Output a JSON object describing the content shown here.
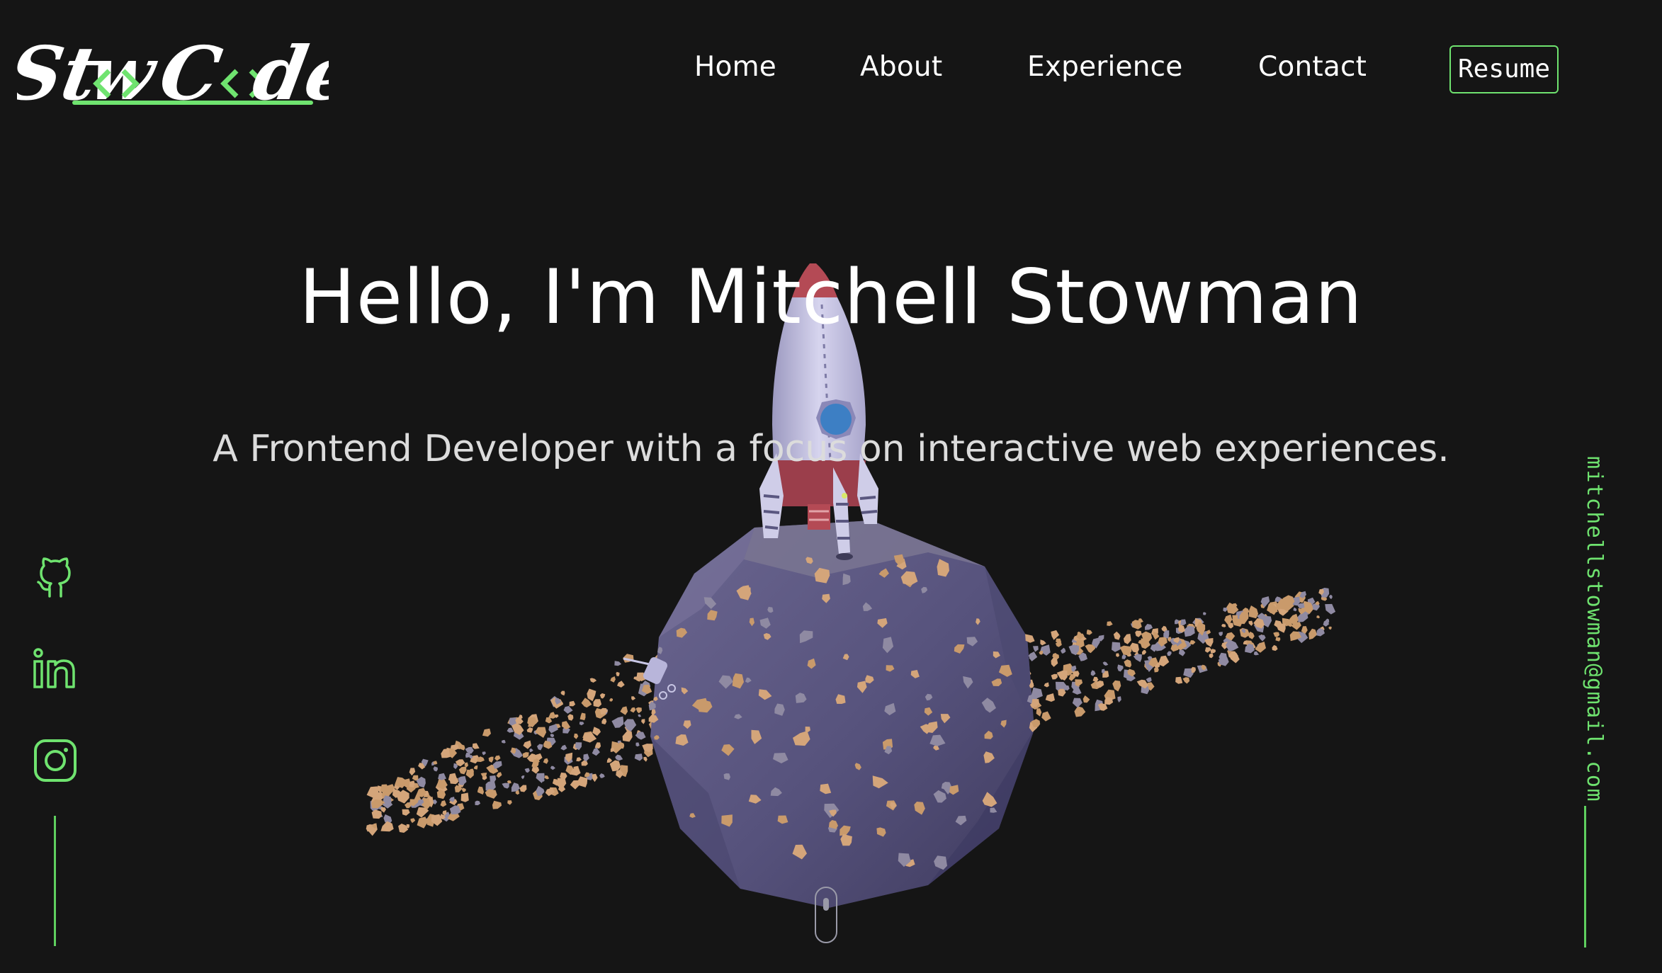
{
  "brand": {
    "logo_text": "StowCode",
    "accent_color": "#6fe36f",
    "background_color": "#151515"
  },
  "nav": {
    "home": "Home",
    "about": "About",
    "experience": "Experience",
    "contact": "Contact",
    "resume": "Resume"
  },
  "hero": {
    "title": "Hello, I'm Mitchell Stowman",
    "subtitle": "A Frontend Developer with a focus on interactive web experiences."
  },
  "socials": [
    {
      "name": "github",
      "icon": "github-icon"
    },
    {
      "name": "linkedin",
      "icon": "linkedin-icon"
    },
    {
      "name": "instagram",
      "icon": "instagram-icon"
    }
  ],
  "contact": {
    "email": "mitchellstowman@gmail.com"
  },
  "scene": {
    "planet_color": "#55507a",
    "rocket_color": "#c8c6e4",
    "rock_colors": [
      "#c99a6b",
      "#8f8aa2",
      "#d4a57a"
    ]
  }
}
